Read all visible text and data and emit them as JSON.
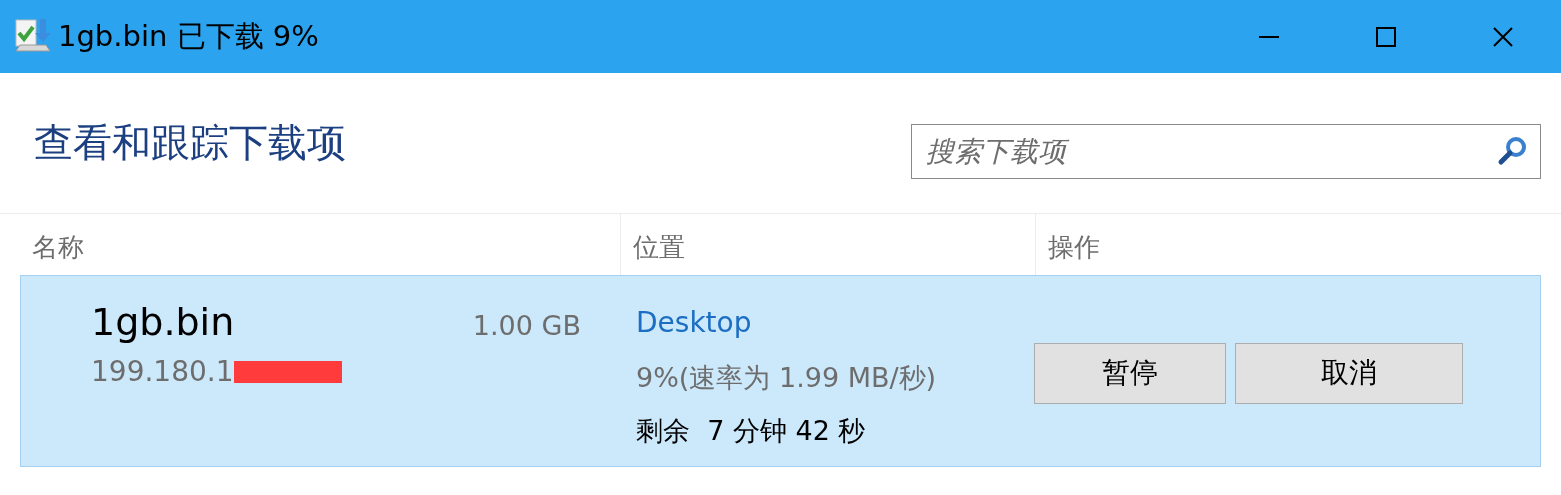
{
  "window": {
    "title": "1gb.bin 已下载 9%"
  },
  "header": {
    "title": "查看和跟踪下载项"
  },
  "search": {
    "placeholder": "搜索下载项"
  },
  "table": {
    "columns": [
      "名称",
      "位置",
      "操作"
    ],
    "rows": [
      {
        "selected": true,
        "name": "1gb.bin",
        "size": "1.00 GB",
        "source": "199.180.1",
        "source_redacted": true,
        "location": "Desktop",
        "progress": "9%(速率为 1.99 MB/秒)",
        "remaining": "剩余  7 分钟 42 秒",
        "actions": [
          "暂停",
          "取消"
        ]
      }
    ]
  }
}
